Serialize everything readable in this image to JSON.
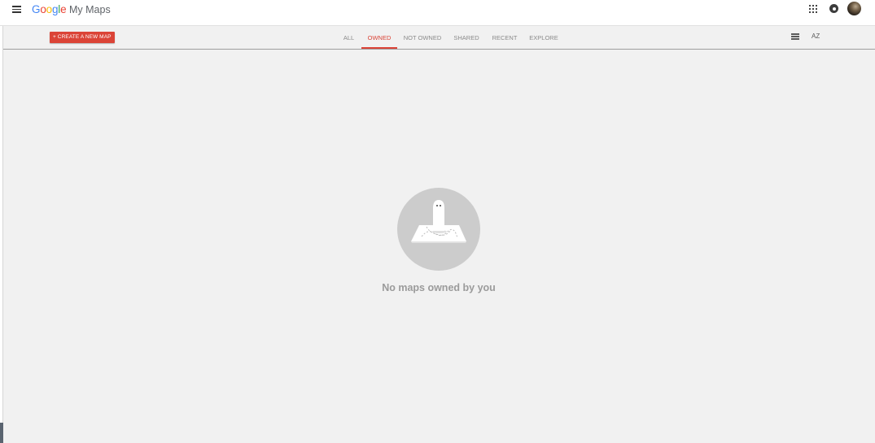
{
  "header": {
    "logo_text": "Google",
    "product_name": "My Maps",
    "icons": [
      "menu-icon",
      "apps-grid-icon",
      "notifications-icon",
      "account-avatar"
    ]
  },
  "toolbar": {
    "create_label": "+ CREATE A NEW MAP",
    "tabs": [
      {
        "label": "ALL",
        "active": false
      },
      {
        "label": "OWNED",
        "active": true
      },
      {
        "label": "NOT OWNED",
        "active": false
      },
      {
        "label": "SHARED",
        "active": false
      },
      {
        "label": "RECENT",
        "active": false
      },
      {
        "label": "EXPLORE",
        "active": false
      }
    ],
    "view_toggle_icon": "list-view-icon",
    "sort_label": "AZ"
  },
  "empty_state": {
    "illustration": "ghost-on-map-icon",
    "message": "No maps owned by you"
  },
  "colors": {
    "accent": "#db4437",
    "background": "#f1f1f1",
    "muted_text": "#9b9b9b",
    "illustration_circle": "#cccccc"
  }
}
